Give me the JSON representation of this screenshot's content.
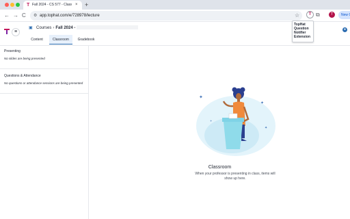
{
  "browser": {
    "tab_title": "Fall 2024 - CS 577 - Classroom",
    "tab_close": "×",
    "new_tab": "+",
    "back": "←",
    "forward": "→",
    "reload": "C",
    "url": "app.tophat.com/e/728978/lecture",
    "star": "☆",
    "extension_letter": "T",
    "profile_initial": "T",
    "new_chrome_label": "New C",
    "colors": {
      "close": "#ff5f57",
      "minimize": "#febc2e",
      "maximize": "#28c840"
    }
  },
  "tooltip": {
    "lines": [
      "TopHat",
      "Question",
      "Notifier",
      "Extension"
    ]
  },
  "header": {
    "breadcrumb_root": "Courses",
    "breadcrumb_sep": "›",
    "breadcrumb_current": "Fall 2024 -",
    "menu_icon": "≡",
    "user_initial": "●"
  },
  "tabs": [
    {
      "label": "Content",
      "active": false
    },
    {
      "label": "Classroom",
      "active": true
    },
    {
      "label": "Gradebook",
      "active": false
    }
  ],
  "sidebar": {
    "presenting_title": "Presenting",
    "presenting_empty": "No slides are being presented",
    "questions_title": "Questions & Attendance",
    "questions_empty": "No questions or attendance sessions are being presented"
  },
  "main": {
    "title": "Classroom",
    "message": "When your professor is presenting in class, items will show up here."
  }
}
